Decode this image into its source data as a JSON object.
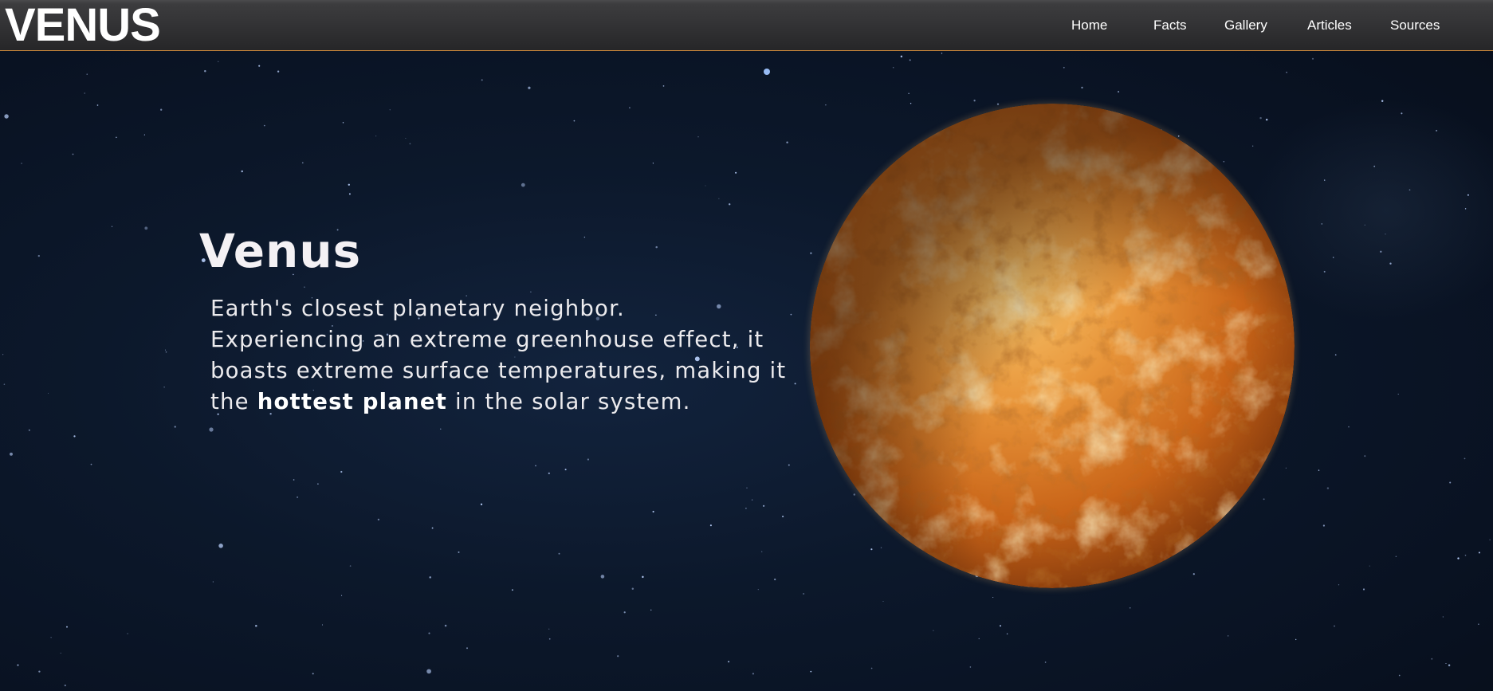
{
  "header": {
    "logo": "VENUS",
    "nav": [
      {
        "label": "Home"
      },
      {
        "label": "Facts"
      },
      {
        "label": "Gallery"
      },
      {
        "label": "Articles"
      },
      {
        "label": "Sources"
      }
    ]
  },
  "hero": {
    "title": "Venus",
    "description": {
      "line1": "Earth's closest planetary neighbor.",
      "line2": "Experiencing an extreme greenhouse effect, it",
      "line3": "boasts extreme surface temperatures, making it",
      "line4_before": "the ",
      "line4_bold": "hottest planet",
      "line4_after": " in the solar system."
    },
    "image": "venus-planet"
  },
  "colors": {
    "header_bg": "#353537",
    "header_border": "#c8863b",
    "background": "#0b1524",
    "text": "#ffffff"
  }
}
